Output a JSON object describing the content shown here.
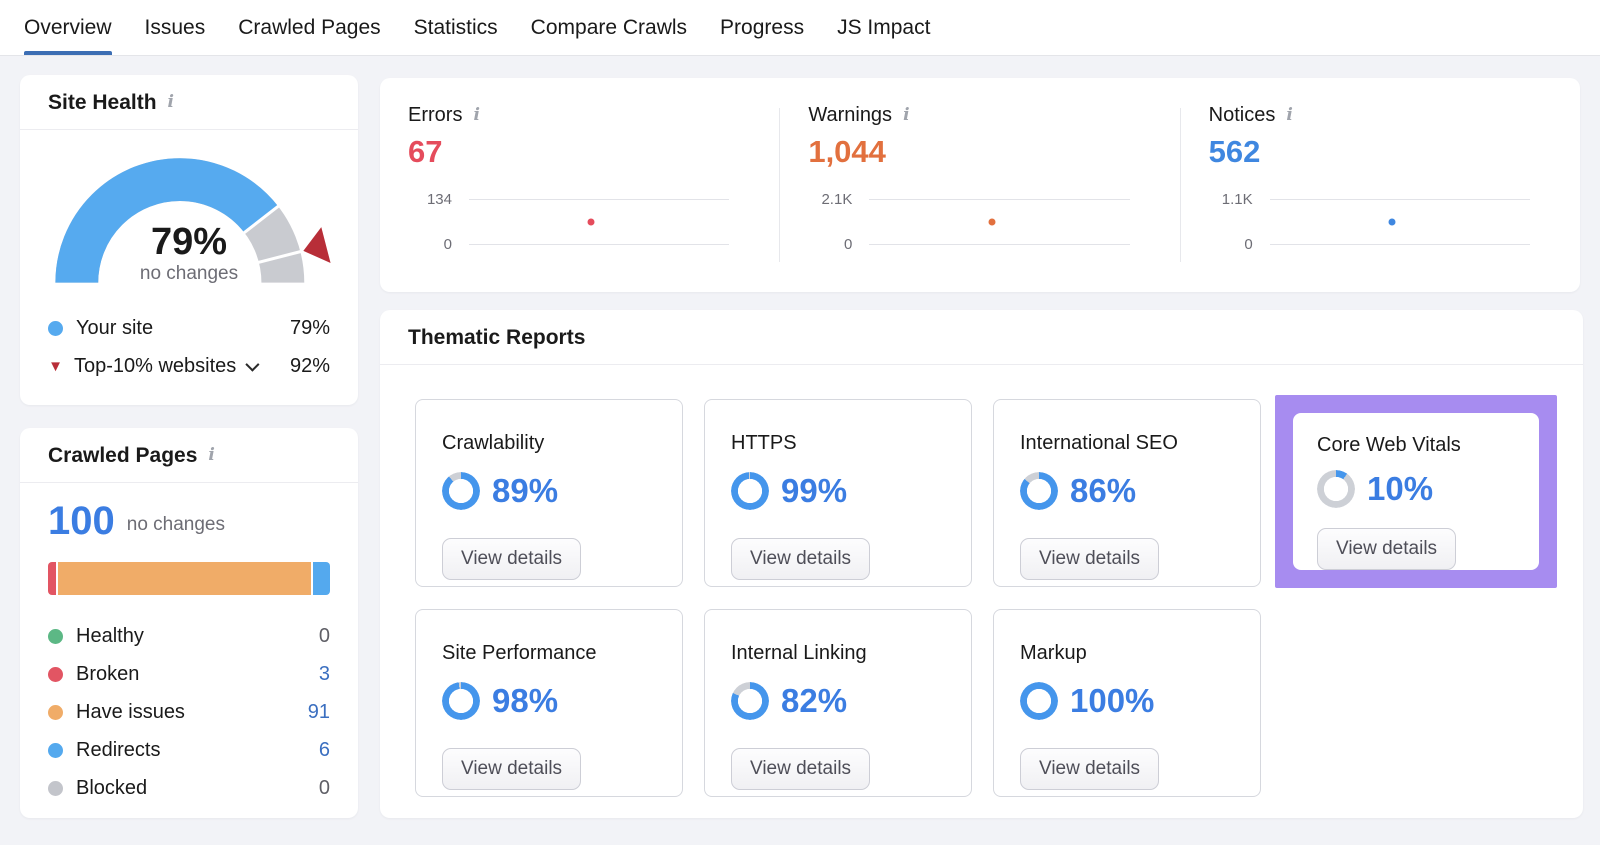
{
  "nav": {
    "tabs": [
      {
        "label": "Overview",
        "active": true
      },
      {
        "label": "Issues",
        "active": false
      },
      {
        "label": "Crawled Pages",
        "active": false
      },
      {
        "label": "Statistics",
        "active": false
      },
      {
        "label": "Compare Crawls",
        "active": false
      },
      {
        "label": "Progress",
        "active": false
      },
      {
        "label": "JS Impact",
        "active": false
      }
    ]
  },
  "colors": {
    "tab_active_underline": "#3c6eb4",
    "accent_blue": "#3b7de2",
    "link_blue": "#3b6fc0",
    "gauge_blue": "#56aaef",
    "gauge_gray": "#c9cbd0",
    "marker_red": "#b82e38",
    "donut_blue": "#4596ec",
    "donut_gray": "#cdd0d6",
    "highlight_purple": "#a78cf0",
    "errors_red": "#e54c5c",
    "warnings_orange": "#e2703e",
    "notices_blue": "#3f87e0"
  },
  "site_health": {
    "title": "Site Health",
    "value_label": "79%",
    "value_pct": 79,
    "change_label": "no changes",
    "benchmark_pct": 92,
    "legend": [
      {
        "label": "Your site",
        "value": "79%"
      },
      {
        "label": "Top-10% websites",
        "value": "92%"
      }
    ]
  },
  "crawled_pages": {
    "title": "Crawled Pages",
    "total": "100",
    "change_label": "no changes",
    "segments": [
      {
        "name": "Broken",
        "pct": 3,
        "color": "#e25563"
      },
      {
        "name": "Have issues",
        "pct": 91,
        "color": "#f0ac68"
      },
      {
        "name": "Redirects",
        "pct": 6,
        "color": "#54a9ee"
      }
    ],
    "legend": [
      {
        "label": "Healthy",
        "value": "0",
        "color": "#5cb885",
        "is_link": false
      },
      {
        "label": "Broken",
        "value": "3",
        "color": "#e25563",
        "is_link": true
      },
      {
        "label": "Have issues",
        "value": "91",
        "color": "#f0ac68",
        "is_link": true
      },
      {
        "label": "Redirects",
        "value": "6",
        "color": "#54a9ee",
        "is_link": true
      },
      {
        "label": "Blocked",
        "value": "0",
        "color": "#c3c5cb",
        "is_link": false
      }
    ]
  },
  "issue_stats": [
    {
      "label": "Errors",
      "value": "67",
      "color": "#e54c5c",
      "axis_max": "134",
      "axis_min": "0",
      "point_value": 67,
      "axis_max_num": 134
    },
    {
      "label": "Warnings",
      "value": "1,044",
      "color": "#e2703e",
      "axis_max": "2.1K",
      "axis_min": "0",
      "point_value": 1044,
      "axis_max_num": 2100
    },
    {
      "label": "Notices",
      "value": "562",
      "color": "#3f87e0",
      "axis_max": "1.1K",
      "axis_min": "0",
      "point_value": 562,
      "axis_max_num": 1100
    }
  ],
  "thematic": {
    "title": "Thematic Reports",
    "button_label": "View details",
    "reports": [
      {
        "name": "Crawlability",
        "pct": 89,
        "pct_label": "89%",
        "highlighted": false
      },
      {
        "name": "HTTPS",
        "pct": 99,
        "pct_label": "99%",
        "highlighted": false
      },
      {
        "name": "International SEO",
        "pct": 86,
        "pct_label": "86%",
        "highlighted": false
      },
      {
        "name": "Core Web Vitals",
        "pct": 10,
        "pct_label": "10%",
        "highlighted": true
      },
      {
        "name": "Site Performance",
        "pct": 98,
        "pct_label": "98%",
        "highlighted": false
      },
      {
        "name": "Internal Linking",
        "pct": 82,
        "pct_label": "82%",
        "highlighted": false
      },
      {
        "name": "Markup",
        "pct": 100,
        "pct_label": "100%",
        "highlighted": false
      }
    ]
  },
  "chart_data": [
    {
      "type": "gauge",
      "title": "Site Health",
      "value": 79,
      "benchmark": 92,
      "range": [
        0,
        100
      ],
      "annotation": "no changes"
    },
    {
      "type": "bar",
      "title": "Crawled Pages breakdown",
      "categories": [
        "Healthy",
        "Broken",
        "Have issues",
        "Redirects",
        "Blocked"
      ],
      "values": [
        0,
        3,
        91,
        6,
        0
      ],
      "total": 100
    },
    {
      "type": "scatter",
      "title": "Errors",
      "values": [
        67
      ],
      "ylim": [
        0,
        134
      ]
    },
    {
      "type": "scatter",
      "title": "Warnings",
      "values": [
        1044
      ],
      "ylim": [
        0,
        2100
      ]
    },
    {
      "type": "scatter",
      "title": "Notices",
      "values": [
        562
      ],
      "ylim": [
        0,
        1100
      ]
    },
    {
      "type": "pie",
      "title": "Thematic Reports scores (%)",
      "categories": [
        "Crawlability",
        "HTTPS",
        "International SEO",
        "Core Web Vitals",
        "Site Performance",
        "Internal Linking",
        "Markup"
      ],
      "values": [
        89,
        99,
        86,
        10,
        98,
        82,
        100
      ]
    }
  ]
}
